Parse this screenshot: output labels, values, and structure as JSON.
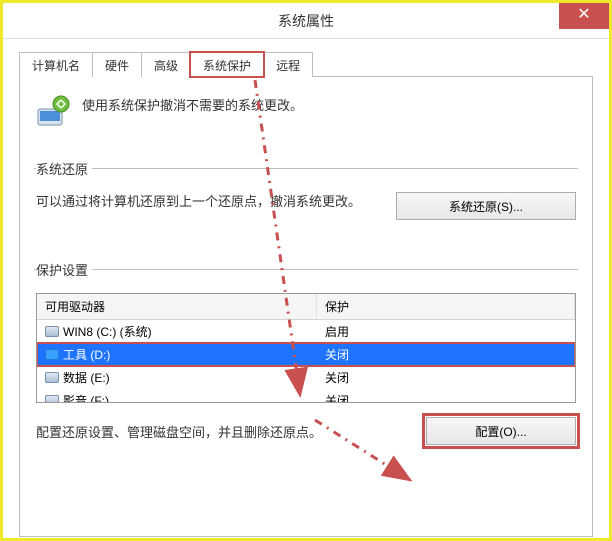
{
  "window": {
    "title": "系统属性"
  },
  "tabs": {
    "items": [
      {
        "label": "计算机名"
      },
      {
        "label": "硬件"
      },
      {
        "label": "高级"
      },
      {
        "label": "系统保护"
      },
      {
        "label": "远程"
      }
    ]
  },
  "intro": {
    "text": "使用系统保护撤消不需要的系统更改。"
  },
  "restore_section": {
    "legend": "系统还原",
    "text": "可以通过将计算机还原到上一个还原点，撤消系统更改。",
    "button": "系统还原(S)..."
  },
  "protect_section": {
    "legend": "保护设置",
    "header_drive": "可用驱动器",
    "header_status": "保护",
    "rows": [
      {
        "name": "WIN8 (C:) (系统)",
        "status": "启用"
      },
      {
        "name": "工具 (D:)",
        "status": "关闭"
      },
      {
        "name": "数据 (E:)",
        "status": "关闭"
      },
      {
        "name": "影音 (F:)",
        "status": "关闭"
      }
    ],
    "config_text": "配置还原设置、管理磁盘空间，并且删除还原点。",
    "config_button": "配置(O)..."
  }
}
